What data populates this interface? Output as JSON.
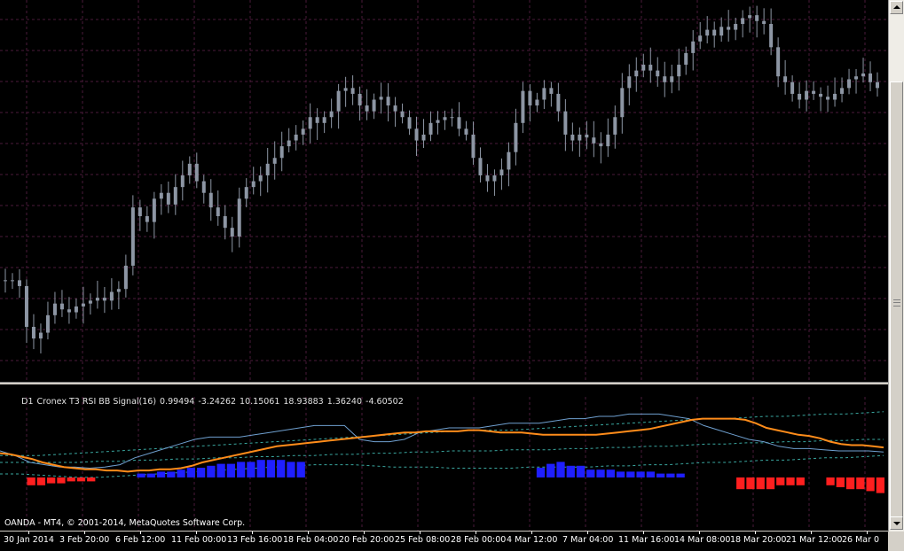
{
  "indicator": {
    "title_parts": [
      "D1",
      "Cronex T3 RSI BB Signal(16)",
      "0.99494",
      "-3.24262",
      "10.15061",
      "18.93883",
      "1.36240",
      "-4.60502"
    ]
  },
  "copyright": "OANDA - MT4, © 2001-2014, MetaQuotes Software Corp.",
  "time_axis": {
    "labels": [
      "30 Jan 2014",
      "3 Feb 20:00",
      "6 Feb 12:00",
      "11 Feb 00:00",
      "13 Feb 16:00",
      "18 Feb 04:00",
      "20 Feb 20:00",
      "25 Feb 08:00",
      "28 Feb 00:00",
      "4 Mar 12:00",
      "7 Mar 04:00",
      "11 Mar 16:00",
      "14 Mar 08:00",
      "18 Mar 20:00",
      "21 Mar 12:00",
      "26 Mar 0"
    ]
  },
  "colors": {
    "background": "#000000",
    "grid": "#4a1a3a",
    "candles": "#8d96a4",
    "rsi_line": "#ff8c1a",
    "signal_line": "#6fa0d0",
    "bands": "#3aa7a0",
    "hist_up": "#1f1fff",
    "hist_down": "#ff1f1f",
    "ui": "#d4d0c8"
  },
  "chart_data": [
    {
      "type": "line",
      "title": "",
      "description_of_series": "price closes read approximately from candle midpoints (vertical scale not printed)",
      "series": [
        {
          "name": "",
          "values": [
            30,
            30,
            28,
            14,
            10,
            12,
            18,
            22,
            20,
            19,
            21,
            22,
            23,
            24,
            23,
            26,
            27,
            35,
            55,
            52,
            50,
            58,
            60,
            56,
            62,
            66,
            70,
            64,
            60,
            55,
            52,
            48,
            45,
            58,
            62,
            64,
            66,
            70,
            72,
            76,
            78,
            80,
            82,
            86,
            84,
            86,
            88,
            95,
            96,
            94,
            90,
            88,
            92,
            93,
            90,
            88,
            86,
            82,
            78,
            80,
            84,
            85,
            86,
            86,
            82,
            80,
            72,
            66,
            64,
            66,
            68,
            74,
            84,
            95,
            90,
            92,
            96,
            94,
            88,
            80,
            78,
            80,
            79,
            77,
            76,
            80,
            86,
            96,
            100,
            102,
            104,
            102,
            100,
            98,
            100,
            104,
            108,
            112,
            114,
            116,
            114,
            117,
            116,
            118,
            120,
            121,
            119,
            118,
            110,
            100,
            98,
            94,
            92,
            95,
            94,
            93,
            92,
            94,
            96,
            99,
            100,
            101,
            98,
            96
          ]
        }
      ],
      "ylim": [
        0,
        125
      ]
    },
    {
      "type": "line",
      "title": "Cronex T3 RSI BB Signal(16)",
      "series": [
        {
          "name": "",
          "values": [
            48,
            47,
            45,
            43,
            40,
            38,
            36,
            35,
            34,
            34,
            33,
            33,
            32,
            33,
            33,
            34,
            34,
            35,
            37,
            40,
            42,
            44,
            46,
            48,
            50,
            52,
            54,
            55,
            56,
            57,
            58,
            59,
            60,
            61,
            62,
            63,
            64,
            65,
            66,
            66,
            67,
            67,
            67,
            67,
            68,
            68,
            67,
            66,
            66,
            66,
            65,
            64,
            64,
            64,
            64,
            64,
            64,
            65,
            66,
            67,
            68,
            69,
            71,
            73,
            75,
            77,
            78,
            78,
            78,
            78,
            77,
            74,
            70,
            68,
            66,
            64,
            63,
            61,
            58,
            56,
            55,
            55,
            54,
            53
          ]
        },
        {
          "name": "",
          "values": [
            50,
            46,
            40,
            38,
            36,
            36,
            35,
            36,
            38,
            44,
            48,
            52,
            56,
            60,
            62,
            62,
            62,
            64,
            66,
            68,
            70,
            72,
            72,
            72,
            60,
            58,
            58,
            60,
            66,
            68,
            70,
            70,
            70,
            72,
            74,
            74,
            74,
            76,
            78,
            78,
            80,
            80,
            82,
            82,
            82,
            80,
            78,
            72,
            68,
            64,
            60,
            58,
            54,
            52,
            52,
            51,
            50,
            50,
            50,
            49
          ]
        },
        {
          "name": "",
          "values": [
            46,
            46,
            46,
            47,
            48,
            49,
            50,
            51,
            52,
            53,
            54,
            55,
            56,
            57,
            58,
            59,
            60,
            61,
            62,
            63,
            64,
            65,
            66,
            67,
            68,
            68,
            68,
            69,
            70,
            71,
            72,
            73,
            74,
            75,
            76,
            77,
            78,
            78,
            79,
            80,
            80,
            81,
            82,
            82,
            83,
            84
          ]
        },
        {
          "name": "",
          "values": [
            30,
            30,
            29,
            28,
            27,
            27,
            28,
            29,
            30,
            31,
            32,
            33,
            34,
            35,
            36,
            37,
            38,
            38,
            38,
            37,
            36,
            36,
            36,
            35,
            35,
            35,
            35,
            36,
            36,
            36,
            36,
            37,
            37,
            38,
            38,
            39,
            40,
            40,
            41,
            42,
            42,
            43,
            44,
            44,
            45,
            46
          ]
        },
        {
          "name": "",
          "values": [
            40,
            40,
            40,
            40,
            40,
            41,
            41,
            42,
            42,
            43,
            43,
            44,
            44,
            45,
            45,
            46,
            46,
            47,
            47,
            48,
            48,
            49,
            49,
            50,
            50,
            50,
            51,
            51,
            51,
            52,
            52,
            53,
            53,
            54,
            54,
            55,
            56,
            56,
            57,
            57,
            58,
            58,
            59,
            59,
            60,
            60
          ]
        },
        {
          "name": "",
          "values": [
            0,
            0,
            -4,
            -4,
            -3,
            -3,
            -2,
            -2,
            -2,
            0,
            0,
            0,
            0,
            2,
            2,
            3,
            3,
            4,
            5,
            5,
            6,
            7,
            7,
            8,
            8,
            9,
            9,
            9,
            8,
            8,
            0,
            0,
            0,
            0,
            0,
            0,
            0,
            0,
            0,
            0,
            0,
            0,
            0,
            0,
            0,
            0,
            0,
            0,
            0,
            0,
            0,
            0,
            0,
            5,
            7,
            8,
            6,
            6,
            4,
            4,
            4,
            3,
            3,
            3,
            3,
            2,
            2,
            2,
            0,
            0,
            0,
            0,
            0,
            -6,
            -6,
            -6,
            -6,
            -4,
            -4,
            -4,
            0,
            0,
            -4,
            -5,
            -6,
            -6,
            -7,
            -8
          ]
        }
      ]
    }
  ]
}
